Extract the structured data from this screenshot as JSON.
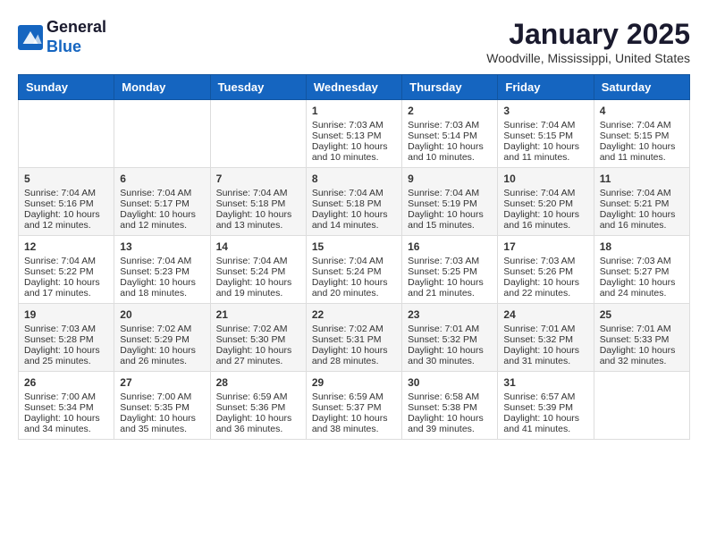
{
  "header": {
    "logo_line1": "General",
    "logo_line2": "Blue",
    "month_title": "January 2025",
    "location": "Woodville, Mississippi, United States"
  },
  "days_of_week": [
    "Sunday",
    "Monday",
    "Tuesday",
    "Wednesday",
    "Thursday",
    "Friday",
    "Saturday"
  ],
  "weeks": [
    [
      {
        "day": "",
        "sunrise": "",
        "sunset": "",
        "daylight": ""
      },
      {
        "day": "",
        "sunrise": "",
        "sunset": "",
        "daylight": ""
      },
      {
        "day": "",
        "sunrise": "",
        "sunset": "",
        "daylight": ""
      },
      {
        "day": "1",
        "sunrise": "Sunrise: 7:03 AM",
        "sunset": "Sunset: 5:13 PM",
        "daylight": "Daylight: 10 hours and 10 minutes."
      },
      {
        "day": "2",
        "sunrise": "Sunrise: 7:03 AM",
        "sunset": "Sunset: 5:14 PM",
        "daylight": "Daylight: 10 hours and 10 minutes."
      },
      {
        "day": "3",
        "sunrise": "Sunrise: 7:04 AM",
        "sunset": "Sunset: 5:15 PM",
        "daylight": "Daylight: 10 hours and 11 minutes."
      },
      {
        "day": "4",
        "sunrise": "Sunrise: 7:04 AM",
        "sunset": "Sunset: 5:15 PM",
        "daylight": "Daylight: 10 hours and 11 minutes."
      }
    ],
    [
      {
        "day": "5",
        "sunrise": "Sunrise: 7:04 AM",
        "sunset": "Sunset: 5:16 PM",
        "daylight": "Daylight: 10 hours and 12 minutes."
      },
      {
        "day": "6",
        "sunrise": "Sunrise: 7:04 AM",
        "sunset": "Sunset: 5:17 PM",
        "daylight": "Daylight: 10 hours and 12 minutes."
      },
      {
        "day": "7",
        "sunrise": "Sunrise: 7:04 AM",
        "sunset": "Sunset: 5:18 PM",
        "daylight": "Daylight: 10 hours and 13 minutes."
      },
      {
        "day": "8",
        "sunrise": "Sunrise: 7:04 AM",
        "sunset": "Sunset: 5:18 PM",
        "daylight": "Daylight: 10 hours and 14 minutes."
      },
      {
        "day": "9",
        "sunrise": "Sunrise: 7:04 AM",
        "sunset": "Sunset: 5:19 PM",
        "daylight": "Daylight: 10 hours and 15 minutes."
      },
      {
        "day": "10",
        "sunrise": "Sunrise: 7:04 AM",
        "sunset": "Sunset: 5:20 PM",
        "daylight": "Daylight: 10 hours and 16 minutes."
      },
      {
        "day": "11",
        "sunrise": "Sunrise: 7:04 AM",
        "sunset": "Sunset: 5:21 PM",
        "daylight": "Daylight: 10 hours and 16 minutes."
      }
    ],
    [
      {
        "day": "12",
        "sunrise": "Sunrise: 7:04 AM",
        "sunset": "Sunset: 5:22 PM",
        "daylight": "Daylight: 10 hours and 17 minutes."
      },
      {
        "day": "13",
        "sunrise": "Sunrise: 7:04 AM",
        "sunset": "Sunset: 5:23 PM",
        "daylight": "Daylight: 10 hours and 18 minutes."
      },
      {
        "day": "14",
        "sunrise": "Sunrise: 7:04 AM",
        "sunset": "Sunset: 5:24 PM",
        "daylight": "Daylight: 10 hours and 19 minutes."
      },
      {
        "day": "15",
        "sunrise": "Sunrise: 7:04 AM",
        "sunset": "Sunset: 5:24 PM",
        "daylight": "Daylight: 10 hours and 20 minutes."
      },
      {
        "day": "16",
        "sunrise": "Sunrise: 7:03 AM",
        "sunset": "Sunset: 5:25 PM",
        "daylight": "Daylight: 10 hours and 21 minutes."
      },
      {
        "day": "17",
        "sunrise": "Sunrise: 7:03 AM",
        "sunset": "Sunset: 5:26 PM",
        "daylight": "Daylight: 10 hours and 22 minutes."
      },
      {
        "day": "18",
        "sunrise": "Sunrise: 7:03 AM",
        "sunset": "Sunset: 5:27 PM",
        "daylight": "Daylight: 10 hours and 24 minutes."
      }
    ],
    [
      {
        "day": "19",
        "sunrise": "Sunrise: 7:03 AM",
        "sunset": "Sunset: 5:28 PM",
        "daylight": "Daylight: 10 hours and 25 minutes."
      },
      {
        "day": "20",
        "sunrise": "Sunrise: 7:02 AM",
        "sunset": "Sunset: 5:29 PM",
        "daylight": "Daylight: 10 hours and 26 minutes."
      },
      {
        "day": "21",
        "sunrise": "Sunrise: 7:02 AM",
        "sunset": "Sunset: 5:30 PM",
        "daylight": "Daylight: 10 hours and 27 minutes."
      },
      {
        "day": "22",
        "sunrise": "Sunrise: 7:02 AM",
        "sunset": "Sunset: 5:31 PM",
        "daylight": "Daylight: 10 hours and 28 minutes."
      },
      {
        "day": "23",
        "sunrise": "Sunrise: 7:01 AM",
        "sunset": "Sunset: 5:32 PM",
        "daylight": "Daylight: 10 hours and 30 minutes."
      },
      {
        "day": "24",
        "sunrise": "Sunrise: 7:01 AM",
        "sunset": "Sunset: 5:32 PM",
        "daylight": "Daylight: 10 hours and 31 minutes."
      },
      {
        "day": "25",
        "sunrise": "Sunrise: 7:01 AM",
        "sunset": "Sunset: 5:33 PM",
        "daylight": "Daylight: 10 hours and 32 minutes."
      }
    ],
    [
      {
        "day": "26",
        "sunrise": "Sunrise: 7:00 AM",
        "sunset": "Sunset: 5:34 PM",
        "daylight": "Daylight: 10 hours and 34 minutes."
      },
      {
        "day": "27",
        "sunrise": "Sunrise: 7:00 AM",
        "sunset": "Sunset: 5:35 PM",
        "daylight": "Daylight: 10 hours and 35 minutes."
      },
      {
        "day": "28",
        "sunrise": "Sunrise: 6:59 AM",
        "sunset": "Sunset: 5:36 PM",
        "daylight": "Daylight: 10 hours and 36 minutes."
      },
      {
        "day": "29",
        "sunrise": "Sunrise: 6:59 AM",
        "sunset": "Sunset: 5:37 PM",
        "daylight": "Daylight: 10 hours and 38 minutes."
      },
      {
        "day": "30",
        "sunrise": "Sunrise: 6:58 AM",
        "sunset": "Sunset: 5:38 PM",
        "daylight": "Daylight: 10 hours and 39 minutes."
      },
      {
        "day": "31",
        "sunrise": "Sunrise: 6:57 AM",
        "sunset": "Sunset: 5:39 PM",
        "daylight": "Daylight: 10 hours and 41 minutes."
      },
      {
        "day": "",
        "sunrise": "",
        "sunset": "",
        "daylight": ""
      }
    ]
  ]
}
